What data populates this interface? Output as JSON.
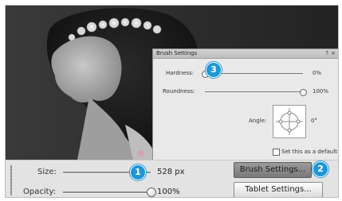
{
  "brush_settings_panel": {
    "title": "Brush Settings",
    "help_icon": "?",
    "close_icon": "×",
    "hardness": {
      "label": "Hardness:",
      "value": "0%",
      "level": 0.0
    },
    "roundness": {
      "label": "Roundness:",
      "value": "100%",
      "level": 1.0
    },
    "angle": {
      "label": "Angle:",
      "value": "0°"
    },
    "set_default": {
      "label": "Set this as a default",
      "checked": false
    }
  },
  "options_bar": {
    "size": {
      "label": "Size:",
      "value": "528 px",
      "level": 0.82
    },
    "opacity": {
      "label": "Opacity:",
      "value": "100%",
      "level": 1.0
    },
    "brush_settings_button": "Brush Settings...",
    "tablet_settings_button": "Tablet Settings..."
  },
  "callouts": [
    "1",
    "2",
    "3"
  ],
  "colors": {
    "callout": "#1f97d6",
    "panel_bg": "#e9e9e9",
    "bar_bg": "#e3e3e3"
  }
}
